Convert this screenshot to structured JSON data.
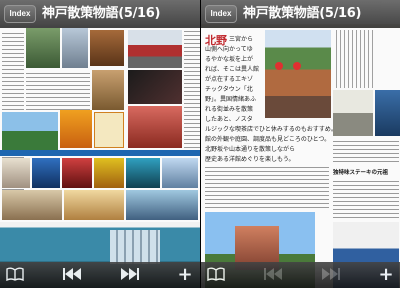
{
  "left_view": {
    "index_label": "Index",
    "title": "神戸散策物語(5/16)",
    "toolbar": {
      "book_icon": "book-icon",
      "prev_icon": "skip-back-icon",
      "next_icon": "skip-forward-icon",
      "add_label": "+"
    }
  },
  "right_view": {
    "index_label": "Index",
    "title": "神戸散策物語(5/16)",
    "heading": "北野",
    "article_lines": [
      "三宮から",
      "山側へ向かってゆ",
      "るやかな坂を上が",
      "れば、そこは異人館",
      "が点在するエキゾ",
      "チックタウン「北",
      "野」。異国情緒あふ",
      "れる街並みを散策",
      "したあと、ノスタ",
      "ルジックな喫茶店でひと休みするのもおすすめ。",
      "館の外観や庭園、調度品も見どころのひとつ。",
      "北野坂や山本通りを散策しながら",
      "歴史ある洋館めぐりを楽しもう。"
    ],
    "sidebar_heading": "独特味ステーキの元祖",
    "toolbar": {
      "book_icon": "book-icon",
      "prev_icon": "skip-back-icon",
      "next_icon": "skip-forward-icon",
      "add_label": "+"
    }
  },
  "colors": {
    "bar": "#2a2a2a",
    "accent": "#c0282d",
    "blue": "#1e66b0"
  }
}
